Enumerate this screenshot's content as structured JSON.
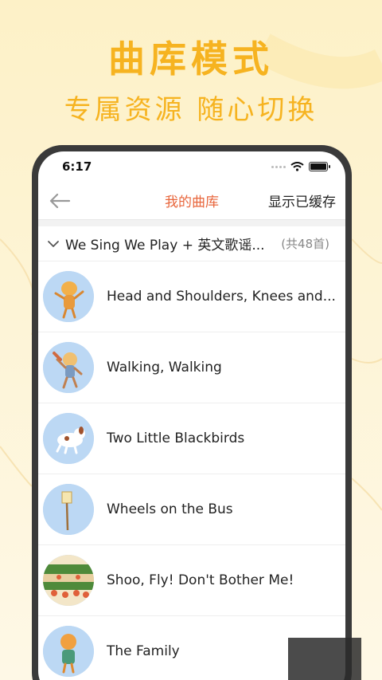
{
  "promo": {
    "title": "曲库模式",
    "subtitle": "专属资源 随心切换"
  },
  "status_bar": {
    "time": "6:17",
    "icons": [
      "signal-dots-icon",
      "wifi-icon",
      "battery-icon"
    ]
  },
  "nav": {
    "back_icon": "back-arrow-icon",
    "title": "我的曲库",
    "right_action": "显示已缓存"
  },
  "album": {
    "name": "We Sing We Play + 英文歌谣...",
    "count": "(共48首)"
  },
  "songs": [
    {
      "title": "Head and Shoulders, Knees and..."
    },
    {
      "title": "Walking, Walking"
    },
    {
      "title": "Two Little Blackbirds"
    },
    {
      "title": "Wheels on the Bus"
    },
    {
      "title": "Shoo, Fly! Don't Bother Me!"
    },
    {
      "title": "The Family"
    }
  ],
  "colors": {
    "accent_yellow": "#f6b320",
    "title_orange": "#e8663c",
    "thumb_blue": "#bcd8f4"
  }
}
